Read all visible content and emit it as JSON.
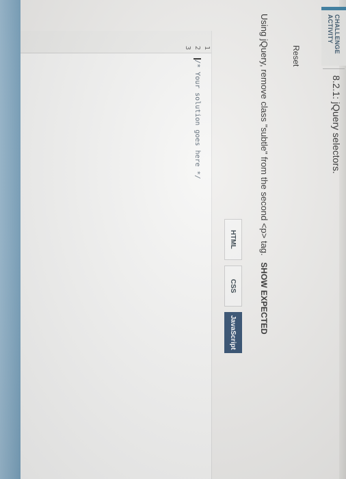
{
  "banner": {
    "line1": "CHALLENGE",
    "line2": "ACTIVITY"
  },
  "activity_title": "8.2.1: jQuery selectors.",
  "reset_label": "Reset",
  "instructions": {
    "text": "Using jQuery, remove class \"subtle\" from the second <p> tag.",
    "show_expected": "SHOW EXPECTED"
  },
  "tabs": [
    {
      "label": "HTML",
      "active": false
    },
    {
      "label": "CSS",
      "active": false
    },
    {
      "label": "JavaScript",
      "active": true
    }
  ],
  "editor": {
    "line_numbers": [
      "1",
      "2",
      "3"
    ],
    "lines": [
      "",
      "/* Your solution goes here */",
      ""
    ]
  },
  "colors": {
    "accent": "#3a7fa3",
    "active_tab": "#2c4a6c",
    "bottom_strip": "#7ba4bf"
  }
}
